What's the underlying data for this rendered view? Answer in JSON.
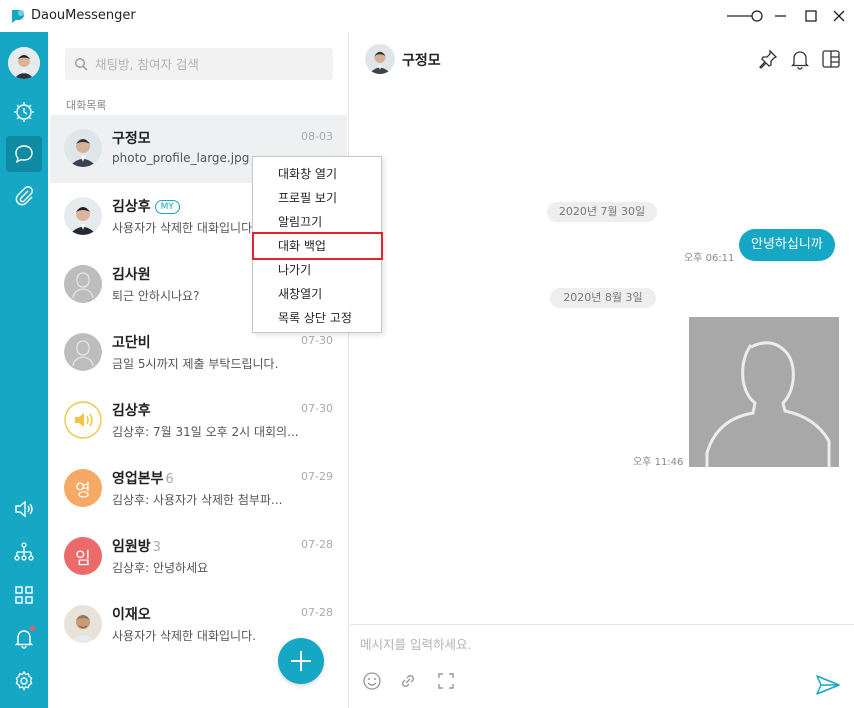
{
  "app": {
    "title": "DaouMessenger"
  },
  "search": {
    "placeholder": "채팅방, 참여자 검색"
  },
  "list": {
    "section_label": "대화목록",
    "conversations": [
      {
        "name": "구정모",
        "preview": "photo_profile_large.jpg",
        "date": "08-03"
      },
      {
        "name": "김상후",
        "badge": "MY",
        "preview": "사용자가 삭제한 대화입니다.",
        "date": ""
      },
      {
        "name": "김사원",
        "preview": "퇴근 안하시나요?",
        "date": ""
      },
      {
        "name": "고단비",
        "preview": "금일 5시까지 제출 부탁드립니다.",
        "date": "07-30"
      },
      {
        "name": "김상후",
        "preview": "김상후: 7월 31일 오후 2시 대회의...",
        "date": "07-30"
      },
      {
        "name": "영업본부",
        "count": "6",
        "avatar_letter": "영",
        "preview": "김상후: 사용자가 삭제한 첨부파...",
        "date": "07-29"
      },
      {
        "name": "임원방",
        "count": "3",
        "avatar_letter": "임",
        "preview": "김상후: 안녕하세요",
        "date": "07-28"
      },
      {
        "name": "이재오",
        "preview": "사용자가 삭제한 대화입니다.",
        "date": "07-28"
      }
    ]
  },
  "context_menu": {
    "items": [
      "대화창 열기",
      "프로필 보기",
      "알림끄기",
      "대화 백업",
      "나가기",
      "새창열기",
      "목록 상단 고정"
    ],
    "highlighted": "대화 백업"
  },
  "chat": {
    "title": "구정모",
    "messages": [
      {
        "type": "date",
        "text": "2020년 7월 30일"
      },
      {
        "type": "text",
        "side": "me",
        "text": "안녕하십니까",
        "time": "오후 06:11"
      },
      {
        "type": "date",
        "text": "2020년 8월 3일"
      },
      {
        "type": "image",
        "side": "me",
        "time": "오후 11:46"
      }
    ],
    "composer_placeholder": "메시지를 입력하세요."
  },
  "colors": {
    "accent": "#15a7c3",
    "rail_active": "#0e8aa3",
    "highlight_border": "#e0262a",
    "avatar_orange": "#f5a964",
    "avatar_red": "#ec6a6a",
    "notify": "#ff5a5a"
  },
  "icons": {
    "rail": [
      "profile-avatar",
      "clock-icon",
      "chat-icon",
      "clip-icon",
      "speaker-icon",
      "org-chart-icon",
      "apps-grid-icon",
      "bell-icon",
      "gear-icon"
    ],
    "chat_header": [
      "pin-icon",
      "bell-icon",
      "panel-icon"
    ],
    "composer": [
      "emoji-icon",
      "link-icon",
      "capture-icon",
      "send-icon"
    ]
  }
}
